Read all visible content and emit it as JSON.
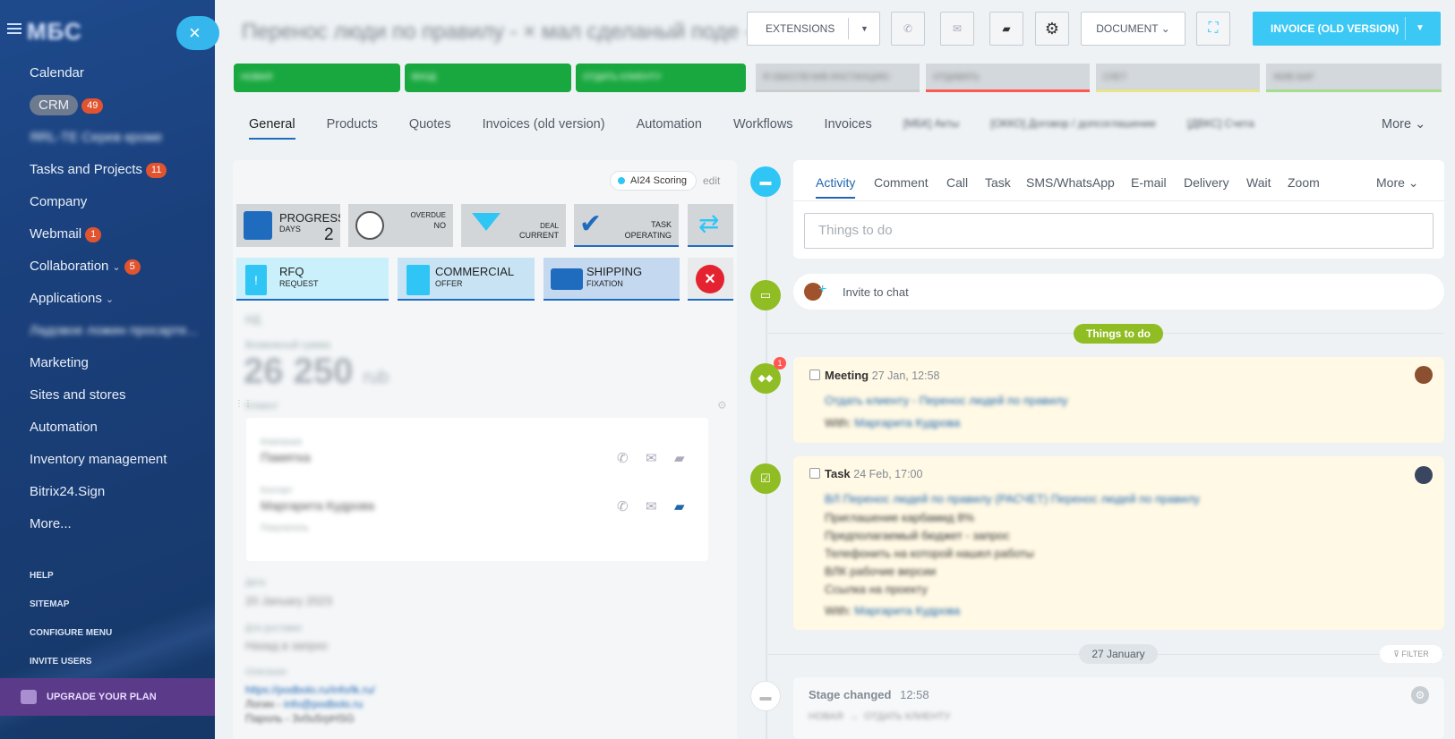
{
  "sidebar": {
    "logo": "МБС",
    "close_symbol": "×",
    "items": [
      {
        "label": "Calendar",
        "badge": ""
      },
      {
        "label": "CRM",
        "badge": "49"
      },
      {
        "label": "ЯRL-ТЕ Серев кроме",
        "badge": ""
      },
      {
        "label": "Tasks and Projects",
        "badge": "11"
      },
      {
        "label": "Company",
        "badge": ""
      },
      {
        "label": "Webmail",
        "badge": "1"
      },
      {
        "label": "Collaboration",
        "badge": "5"
      },
      {
        "label": "Applications",
        "badge": ""
      },
      {
        "label": "Ладовое ложин просарте...",
        "badge": ""
      },
      {
        "label": "Marketing",
        "badge": ""
      },
      {
        "label": "Sites and stores",
        "badge": ""
      },
      {
        "label": "Automation",
        "badge": ""
      },
      {
        "label": "Inventory management",
        "badge": ""
      },
      {
        "label": "Bitrix24.Sign",
        "badge": ""
      },
      {
        "label": "More...",
        "badge": ""
      }
    ],
    "bottom_links": [
      "HELP",
      "SITEMAP",
      "CONFIGURE MENU",
      "INVITE USERS"
    ],
    "upgrade": "UPGRADE YOUR PLAN"
  },
  "header": {
    "title": "Перенос люди по правилу - ×  мал сделаный поде -",
    "extensions": "EXTENSIONS",
    "document": "DOCUMENT",
    "invoice": "INVOICE (OLD VERSION)"
  },
  "stages": [
    "НОВАЯ",
    "ВХОД",
    "ОТДАТЬ КЛИЕНТУ",
    "Я ОБЕСПЕЧИВ ИНСТАНЦИЮ",
    "ОТДАВАТЬ",
    "СЛЕТ",
    "ЖИВ БАР"
  ],
  "tabs": [
    "General",
    "Products",
    "Quotes",
    "Invoices (old version)",
    "Automation",
    "Workflows",
    "Invoices",
    "[МБК] Акты",
    "[ОККО] Договор / допсоглашение",
    "[ДВКС] Счета"
  ],
  "tabs_more": "More",
  "left": {
    "ai_scoring": "AI24 Scoring",
    "edit": "edit",
    "tiles": {
      "progress_title": "PROGRESS",
      "progress_sub": "DAYS",
      "progress_value": "2",
      "overdue_title": "OVERDUE",
      "overdue_value": "NO",
      "deal_title": "DEAL",
      "deal_value": "CURRENT",
      "task_title": "TASK",
      "task_value": "OPERATING",
      "rfq_title": "RFQ",
      "rfq_sub": "REQUEST",
      "commercial_title": "COMMERCIAL",
      "commercial_sub": "OFFER",
      "shipping_title": "SHIPPING",
      "shipping_sub": "FIXATION"
    },
    "fields": {
      "id_label": "ИД",
      "amount_label": "Возможный сумма",
      "amount": "26 250",
      "currency": "rub",
      "client_label": "Клиент",
      "company_label": "Компания",
      "company_value": "Памятка",
      "contact_label": "Контакт",
      "contact_value": "Маргарита Кудрова",
      "contact_role": "Покупатель",
      "date_label": "Дата",
      "date_value": "20 January 2023",
      "source_label": "Для доставки",
      "source_value": "Назад в запрос",
      "comment_label": "Описание",
      "comment_link": "https://podbolo.ru/info/lk.ru/",
      "comment_login_label": "Логин -",
      "comment_login": "info@podbolo.ru",
      "comment_pass": "Пароль - 3v0u5rpHSG"
    }
  },
  "timeline": {
    "tabs": [
      "Activity",
      "Comment",
      "Call",
      "Task",
      "SMS/WhatsApp",
      "E-mail",
      "Delivery",
      "Wait",
      "Zoom"
    ],
    "more": "More",
    "placeholder": "Things to do",
    "invite": "Invite to chat",
    "things_to_do": "Things to do",
    "meeting": {
      "badge": "1",
      "title": "Meeting",
      "time": "27 Jan, 12:58",
      "link": "Отдать клиенту - Перенос людей по правилу",
      "with_label": "With:",
      "with": "Маргарита Кудрова"
    },
    "task": {
      "title": "Task",
      "time": "24 Feb, 17:00",
      "link": "ВЛ Перенос людей по правилу (РАСЧЕТ) Перенос людей по правилу",
      "lines": [
        "Приглашение карбамид 8%",
        "Предполагаемый бюджет - запрос",
        "Телефонить на которой нашел работы",
        "ВЛК рабочие версии",
        "Ссылка на проекту"
      ],
      "with_label": "With:",
      "with": "Маргарита Кудрова"
    },
    "date_pill": "27 January",
    "filter": "FILTER",
    "stage_changed": {
      "title": "Stage changed",
      "time": "12:58",
      "from": "НОВАЯ",
      "to": "ОТДАТЬ КЛИЕНТУ"
    }
  }
}
